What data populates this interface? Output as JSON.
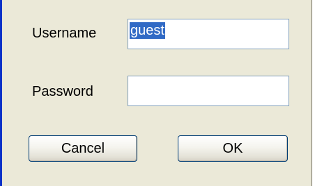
{
  "login": {
    "username_label": "Username",
    "username_value": "guest",
    "password_label": "Password",
    "password_value": "",
    "cancel_label": "Cancel",
    "ok_label": "OK"
  }
}
